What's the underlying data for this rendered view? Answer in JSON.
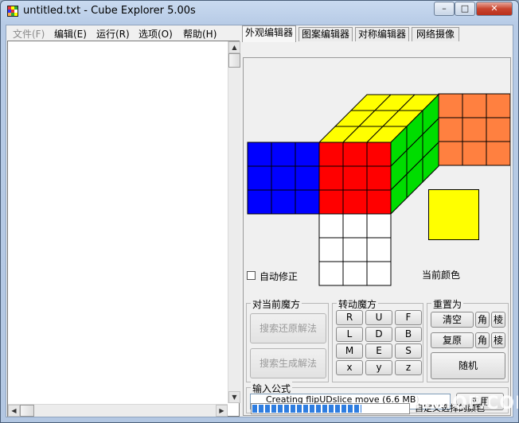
{
  "window": {
    "title": "untitled.txt - Cube Explorer 5.00s",
    "controls": {
      "minimize": "–",
      "maximize": "□",
      "close": "✕"
    }
  },
  "menu": [
    {
      "label": "文件(F)",
      "enabled": false
    },
    {
      "label": "编辑(E)",
      "enabled": true
    },
    {
      "label": "运行(R)",
      "enabled": true
    },
    {
      "label": "选项(O)",
      "enabled": true
    },
    {
      "label": "帮助(H)",
      "enabled": true
    }
  ],
  "tabs": [
    "外观编辑器",
    "图案编辑器",
    "对称编辑器",
    "网络摄像"
  ],
  "active_tab": 0,
  "facelet_editor": {
    "auto_correct_label": "自动修正",
    "auto_correct_checked": false,
    "current_color_label": "当前颜色",
    "current_color": "#ffff00",
    "colors": {
      "up": "#ffff00",
      "left": "#0000ff",
      "front": "#ff0000",
      "right": "#00dd00",
      "back": "#ff8040",
      "down": "#ffffff"
    }
  },
  "group_current_cube": {
    "title": "对当前魔方",
    "solve_button": "搜索还原解法",
    "generate_button": "搜索生成解法"
  },
  "group_turn": {
    "title": "转动魔方",
    "buttons": [
      [
        "R",
        "U",
        "F"
      ],
      [
        "L",
        "D",
        "B"
      ],
      [
        "M",
        "E",
        "S"
      ],
      [
        "x",
        "y",
        "z"
      ]
    ]
  },
  "group_reset": {
    "title": "重置为",
    "clear_button": "清空",
    "restore_button": "复原",
    "corner_label": "角",
    "edge_label": "棱",
    "random_button": "随机"
  },
  "formula": {
    "title": "输入公式",
    "value": "",
    "apply_button": "应用"
  },
  "status": {
    "text": "Creating flipUDslice move (6.6 MB)",
    "progress_fraction": 0.7,
    "right_text": "自定义选择的颜色"
  },
  "watermark": "ITMOP.COM"
}
